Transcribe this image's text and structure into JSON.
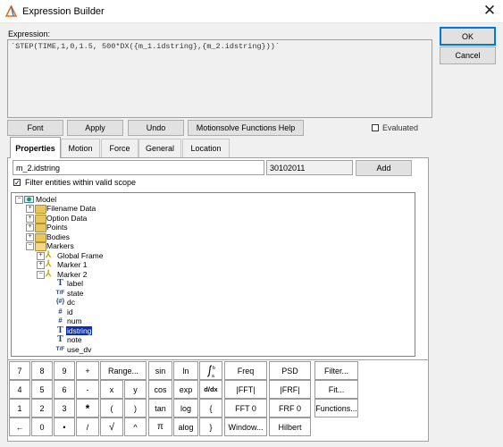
{
  "window": {
    "title": "Expression Builder",
    "close_glyph": "✕"
  },
  "expression": {
    "label": "Expression:",
    "value": "`STEP(TIME,1,0,1.5, 500*DX({m_1.idstring},{m_2.idstring}))`"
  },
  "dialog_buttons": {
    "ok": "OK",
    "cancel": "Cancel"
  },
  "toolbar": {
    "font": "Font",
    "apply": "Apply",
    "undo": "Undo",
    "help": "Motionsolve Functions Help"
  },
  "evaluated": {
    "label": "Evaluated",
    "checked": false
  },
  "tabs": [
    {
      "label": "Properties",
      "active": true
    },
    {
      "label": "Motion",
      "active": false
    },
    {
      "label": "Force",
      "active": false
    },
    {
      "label": "General",
      "active": false
    },
    {
      "label": "Location",
      "active": false
    }
  ],
  "properties": {
    "entity_value": "m_2.idstring",
    "id_value": "30102011",
    "add_label": "Add",
    "filter_label": "Filter entities within valid scope",
    "filter_checked": true
  },
  "tree": [
    {
      "label": "Model",
      "icon": "model-icon",
      "expander": "−"
    },
    {
      "label": "Filename Data",
      "icon": "folder-icon",
      "expander": "+"
    },
    {
      "label": "Option Data",
      "icon": "folder-icon",
      "expander": "+"
    },
    {
      "label": "Points",
      "icon": "folder-icon",
      "expander": "+"
    },
    {
      "label": "Bodies",
      "icon": "folder-icon",
      "expander": "+"
    },
    {
      "label": "Markers",
      "icon": "folder-icon",
      "expander": "−"
    },
    {
      "label": "Global Frame",
      "icon": "marker-icon",
      "expander": "+"
    },
    {
      "label": "Marker 1",
      "icon": "marker-icon",
      "expander": "+"
    },
    {
      "label": "Marker 2",
      "icon": "marker-icon",
      "expander": "−"
    },
    {
      "label": "label",
      "icon": "text-property-icon",
      "glyph": "T"
    },
    {
      "label": "state",
      "icon": "boolean-property-icon",
      "glyph": "T/F"
    },
    {
      "label": "dc",
      "icon": "dc-property-icon",
      "glyph": "{#}"
    },
    {
      "label": "id",
      "icon": "integer-property-icon",
      "glyph": "#"
    },
    {
      "label": "num",
      "icon": "integer-property-icon",
      "glyph": "#"
    },
    {
      "label": "idstring",
      "icon": "text-property-icon",
      "glyph": "T",
      "selected": true
    },
    {
      "label": "note",
      "icon": "text-property-icon",
      "glyph": "T"
    },
    {
      "label": "use_dv",
      "icon": "boolean-property-icon",
      "glyph": "T/F"
    }
  ],
  "keypad": {
    "rows": [
      [
        "7",
        "8",
        "9",
        "+",
        "Range...",
        "sin",
        "ln",
        "∫",
        "Freq",
        "PSD",
        "Filter..."
      ],
      [
        "4",
        "5",
        "6",
        "-",
        "x",
        "y",
        "cos",
        "exp",
        "d/dx",
        "|FFT|",
        "|FRF|",
        "Fit..."
      ],
      [
        "1",
        "2",
        "3",
        "*",
        "(",
        ")",
        "tan",
        "log",
        "{",
        "FFT 0",
        "FRF 0",
        "Functions..."
      ],
      [
        "←",
        "0",
        "•",
        "/",
        "√",
        "^",
        "π",
        "alog",
        "}",
        "Window...",
        "Hilbert"
      ]
    ]
  }
}
